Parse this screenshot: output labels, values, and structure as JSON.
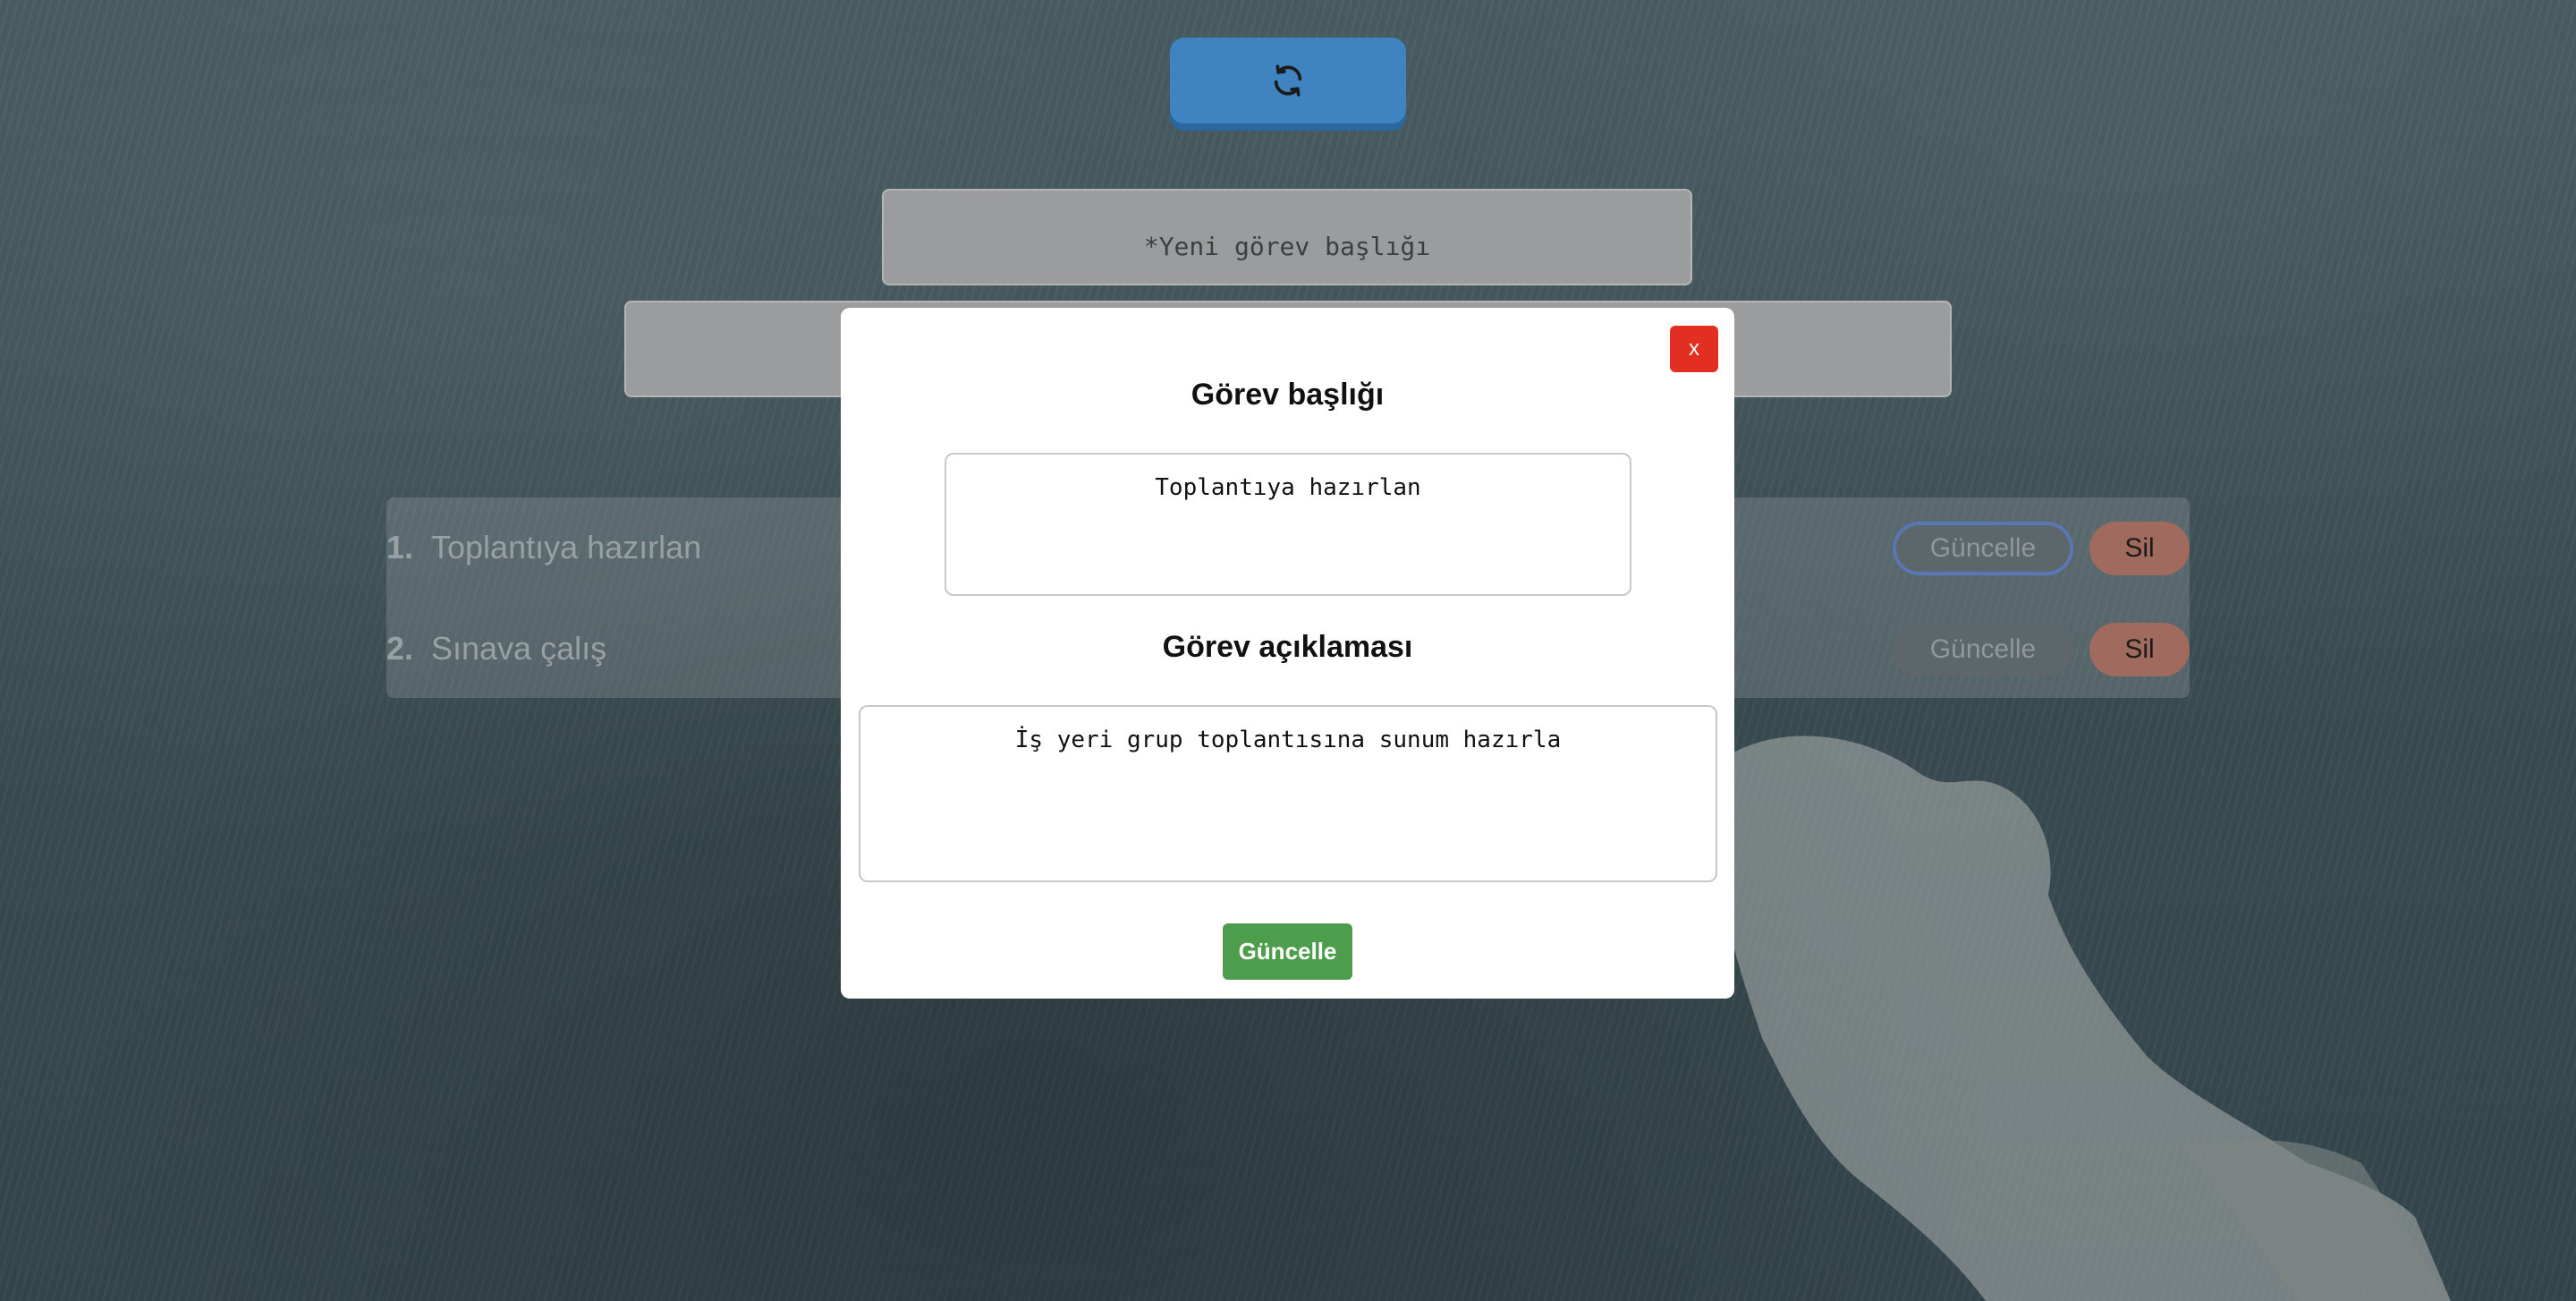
{
  "header": {
    "refresh_icon": "refresh-icon"
  },
  "form": {
    "title_placeholder": "*Yeni görev başlığı",
    "description_placeholder": ""
  },
  "tasks": [
    {
      "number": "1.",
      "title": "Toplantıya hazırlan",
      "update_label": "Güncelle",
      "delete_label": "Sil"
    },
    {
      "number": "2.",
      "title": "Sınava çalış",
      "update_label": "Güncelle",
      "delete_label": "Sil"
    }
  ],
  "modal": {
    "close_label": "x",
    "title_heading": "Görev başlığı",
    "title_value": "Toplantıya hazırlan",
    "description_heading": "Görev açıklaması",
    "description_value": "İş yeri grup toplantısına sunum hazırla",
    "submit_label": "Güncelle"
  },
  "colors": {
    "refresh_button": "#3f83c1",
    "close_button": "#e32f22",
    "submit_button": "#4e9d4c",
    "delete_button": "#a16a5e"
  }
}
